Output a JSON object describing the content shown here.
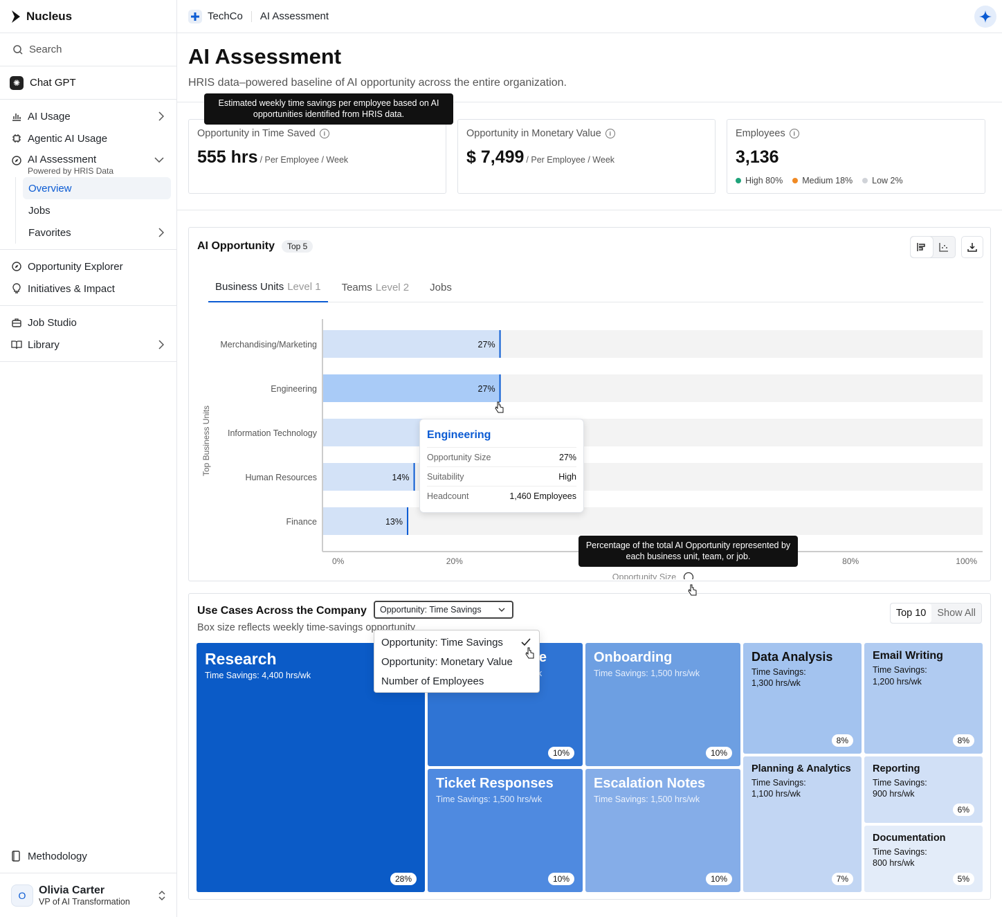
{
  "brand": "Nucleus",
  "sidebar": {
    "search": "Search",
    "chatgpt": "Chat GPT",
    "items": [
      {
        "label": "AI Usage",
        "icon": "bar-chart-icon"
      },
      {
        "label": "Agentic AI Usage",
        "icon": "chip-icon"
      },
      {
        "label": "AI Assessment",
        "sublabel": "Powered by HRIS Data",
        "icon": "compass-icon"
      },
      {
        "label": "Overview"
      },
      {
        "label": "Jobs"
      },
      {
        "label": "Favorites"
      },
      {
        "label": "Opportunity Explorer",
        "icon": "compass-icon"
      },
      {
        "label": "Initiatives & Impact",
        "icon": "lightbulb-icon"
      },
      {
        "label": "Job Studio",
        "icon": "briefcase-icon"
      },
      {
        "label": "Library",
        "icon": "book-icon"
      }
    ],
    "methodology": "Methodology",
    "user": {
      "initial": "O",
      "name": "Olivia Carter",
      "role": "VP of AI Transformation"
    }
  },
  "topbar": {
    "org": "TechCo",
    "page": "AI Assessment"
  },
  "page": {
    "title": "AI Assessment",
    "subtitle": "HRIS data–powered baseline of AI opportunity across the entire organization."
  },
  "kpis": {
    "time": {
      "label": "Opportunity in Time Saved",
      "value": "555 hrs",
      "unit": "/ Per Employee / Week",
      "tooltip": "Estimated weekly time savings per employee based on AI opportunities identified from HRIS data."
    },
    "money": {
      "label": "Opportunity in Monetary Value",
      "value": "$ 7,499",
      "unit": "/ Per Employee / Week"
    },
    "employees": {
      "label": "Employees",
      "value": "3,136",
      "legend": [
        {
          "label": "High 80%",
          "color": "#1fa37a"
        },
        {
          "label": "Medium 18%",
          "color": "#f08a24"
        },
        {
          "label": "Low 2%",
          "color": "#d0d3d8"
        }
      ]
    }
  },
  "opportunity": {
    "title": "AI Opportunity",
    "badge": "Top 5",
    "tabs": [
      {
        "label": "Business Units",
        "level": "Level 1"
      },
      {
        "label": "Teams",
        "level": "Level 2"
      },
      {
        "label": "Jobs",
        "level": ""
      }
    ],
    "tooltip": "Percentage of the total AI Opportunity represented by each business unit, team, or job.",
    "popup": {
      "title": "Engineering",
      "rows": [
        {
          "k": "Opportunity Size",
          "v": "27%"
        },
        {
          "k": "Suitability",
          "v": "High"
        },
        {
          "k": "Headcount",
          "v": "1,460 Employees"
        }
      ]
    }
  },
  "chart_data": {
    "type": "bar",
    "orientation": "horizontal",
    "categories": [
      "Merchandising/Marketing",
      "Engineering",
      "Information Technology",
      "Human Resources",
      "Finance"
    ],
    "values": [
      27,
      27,
      20,
      14,
      13
    ],
    "labels": [
      "27%",
      "27%",
      "",
      "14%",
      "13%"
    ],
    "ylabel": "Top Business Units",
    "xlabel": "Opportunity Size",
    "xlim": [
      0,
      100
    ],
    "xticks": [
      "0%",
      "20%",
      "",
      "",
      "80%",
      "100%"
    ],
    "highlight": "Engineering",
    "colors": {
      "bar": "#d3e2f7",
      "highlight": "#a9cbf7",
      "track": "#f3f3f3",
      "marker": "#0b5bd3"
    }
  },
  "usecases": {
    "title": "Use Cases Across the Company",
    "subtitle": "Box size reflects weekly time-savings opportunity",
    "select": "Opportunity: Time Savings",
    "options": [
      "Opportunity: Time Savings",
      "Opportunity: Monetary Value",
      "Number of Employees"
    ],
    "toggle": [
      "Top 10",
      "Show All"
    ],
    "tiles": [
      {
        "name": "Research",
        "savings": "Time Savings: 4,400 hrs/wk",
        "pct": "28%"
      },
      {
        "name": "Knowledge Base",
        "savings": "Time Savings: 1,500 hrs/wk",
        "pct": "10%"
      },
      {
        "name": "Onboarding",
        "savings": "Time Savings: 1,500 hrs/wk",
        "pct": "10%"
      },
      {
        "name": "Data Analysis",
        "savings": "Time Savings:\n1,300 hrs/wk",
        "pct": "8%"
      },
      {
        "name": "Email Writing",
        "savings": "Time Savings:\n1,200 hrs/wk",
        "pct": "8%"
      },
      {
        "name": "Ticket Responses",
        "savings": "Time Savings: 1,500 hrs/wk",
        "pct": "10%"
      },
      {
        "name": "Escalation Notes",
        "savings": "Time Savings: 1,500 hrs/wk",
        "pct": "10%"
      },
      {
        "name": "Planning & Analytics",
        "savings": "Time Savings:\n1,100 hrs/wk",
        "pct": "7%"
      },
      {
        "name": "Reporting",
        "savings": "Time Savings:\n900 hrs/wk",
        "pct": "6%"
      },
      {
        "name": "Documentation",
        "savings": "Time Savings:\n800 hrs/wk",
        "pct": "5%"
      }
    ]
  }
}
